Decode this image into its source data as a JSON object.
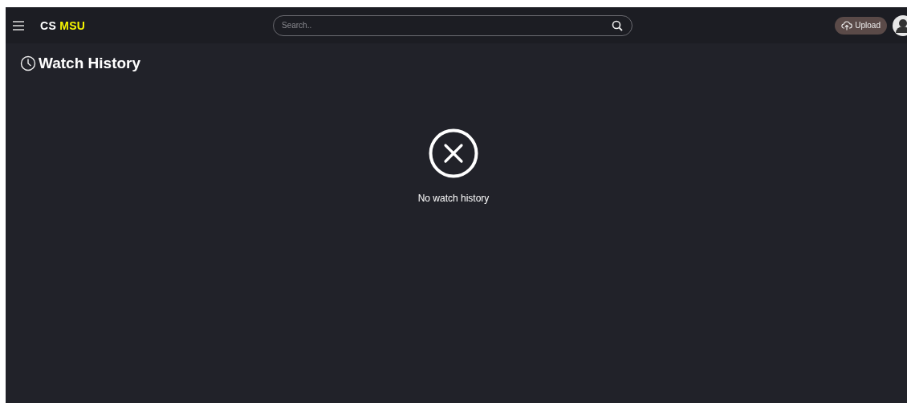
{
  "brand": {
    "part_1": "CS",
    "part_2": "MSU"
  },
  "search": {
    "placeholder": "Search.."
  },
  "upload_button": {
    "label": "Upload"
  },
  "page_title": "Watch History",
  "empty_state": {
    "message": "No watch history"
  }
}
